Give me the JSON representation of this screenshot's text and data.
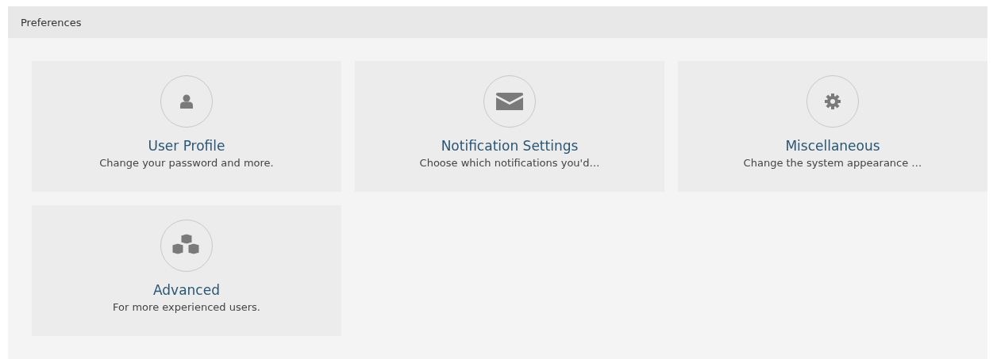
{
  "panel": {
    "title": "Preferences"
  },
  "cards": [
    {
      "title": "User Profile",
      "description": "Change your password and more."
    },
    {
      "title": "Notification Settings",
      "description": "Choose which notifications you'd…"
    },
    {
      "title": "Miscellaneous",
      "description": "Change the system appearance …"
    },
    {
      "title": "Advanced",
      "description": "For more experienced users."
    }
  ]
}
